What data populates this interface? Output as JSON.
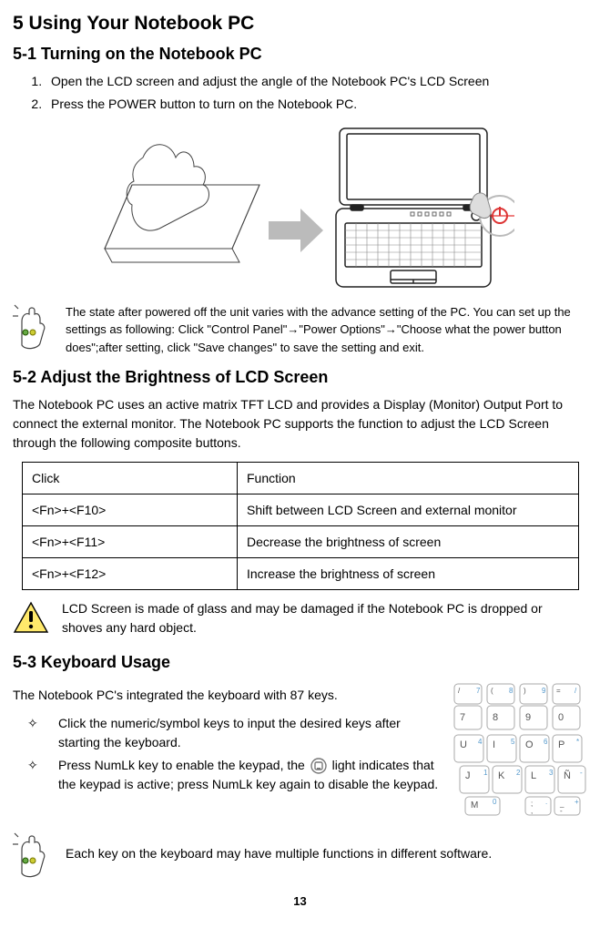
{
  "h1": "5 Using Your Notebook PC",
  "s51": {
    "heading": "5-1 Turning on the Notebook PC",
    "steps": [
      "Open the LCD screen and adjust the angle of the Notebook PC's LCD Screen",
      "Press the POWER button to turn on the Notebook PC."
    ],
    "note": "The state after powered off the unit varies with the advance setting of the PC. You can set up the settings as following: Click \"Control Panel\"→\"Power Options\"→\"Choose what the power button does\";after setting, click \"Save changes\" to save the setting and exit."
  },
  "s52": {
    "heading": "5-2 Adjust the Brightness of LCD Screen",
    "para": "The Notebook PC uses an active matrix TFT LCD and provides a Display (Monitor) Output Port to connect the external monitor. The Notebook PC supports the function to adjust the LCD Screen through the following composite buttons.",
    "table": {
      "header": [
        "Click",
        "Function"
      ],
      "rows": [
        [
          "<Fn>+<F10>",
          "Shift between LCD Screen and external monitor"
        ],
        [
          "<Fn>+<F11>",
          "Decrease the brightness of screen"
        ],
        [
          "<Fn>+<F12>",
          "Increase the brightness of screen"
        ]
      ]
    },
    "warning": "LCD Screen is made of glass and may be damaged if the Notebook PC is dropped or shoves any hard object."
  },
  "s53": {
    "heading": "5-3 Keyboard Usage",
    "para": "The Notebook PC's integrated the keyboard with 87 keys.",
    "bullets": [
      "Click the numeric/symbol keys to input the desired keys after starting the keyboard.",
      "Press NumLk key to enable the keypad, the        light indicates that the keypad is active; press NumLk key again to disable the keypad."
    ],
    "note": "Each key on the keyboard may have multiple functions in different software."
  },
  "page_number": "13"
}
